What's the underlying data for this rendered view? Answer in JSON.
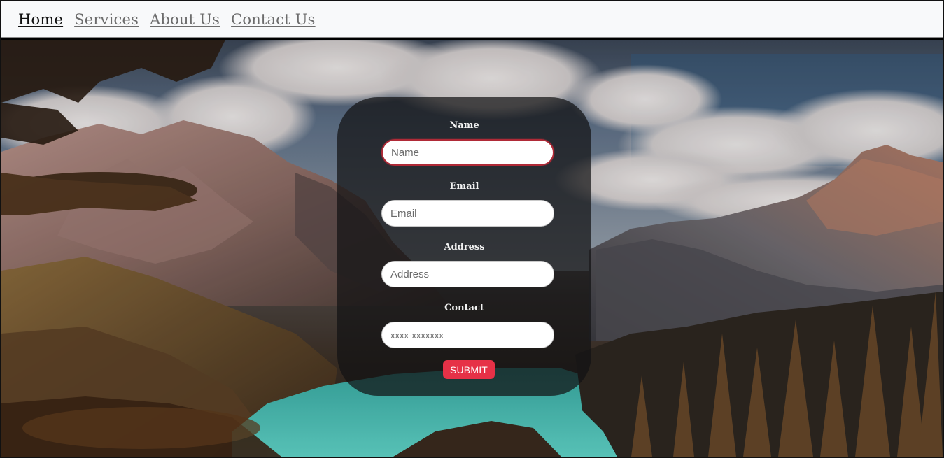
{
  "nav": {
    "items": [
      {
        "label": "Home",
        "active": true
      },
      {
        "label": "Services",
        "active": false
      },
      {
        "label": "About Us",
        "active": false
      },
      {
        "label": "Contact Us",
        "active": false
      }
    ]
  },
  "form": {
    "name_label": "Name",
    "name_placeholder": "Name",
    "email_label": "Email",
    "email_placeholder": "Email",
    "address_label": "Address",
    "address_placeholder": "Address",
    "contact_label": "Contact",
    "contact_placeholder": "xxxx-xxxxxxx",
    "submit_label": "SUBMIT"
  },
  "colors": {
    "submit": "#e63147",
    "focus_border": "#b02a37",
    "navbar_bg": "#f8f9fa"
  }
}
